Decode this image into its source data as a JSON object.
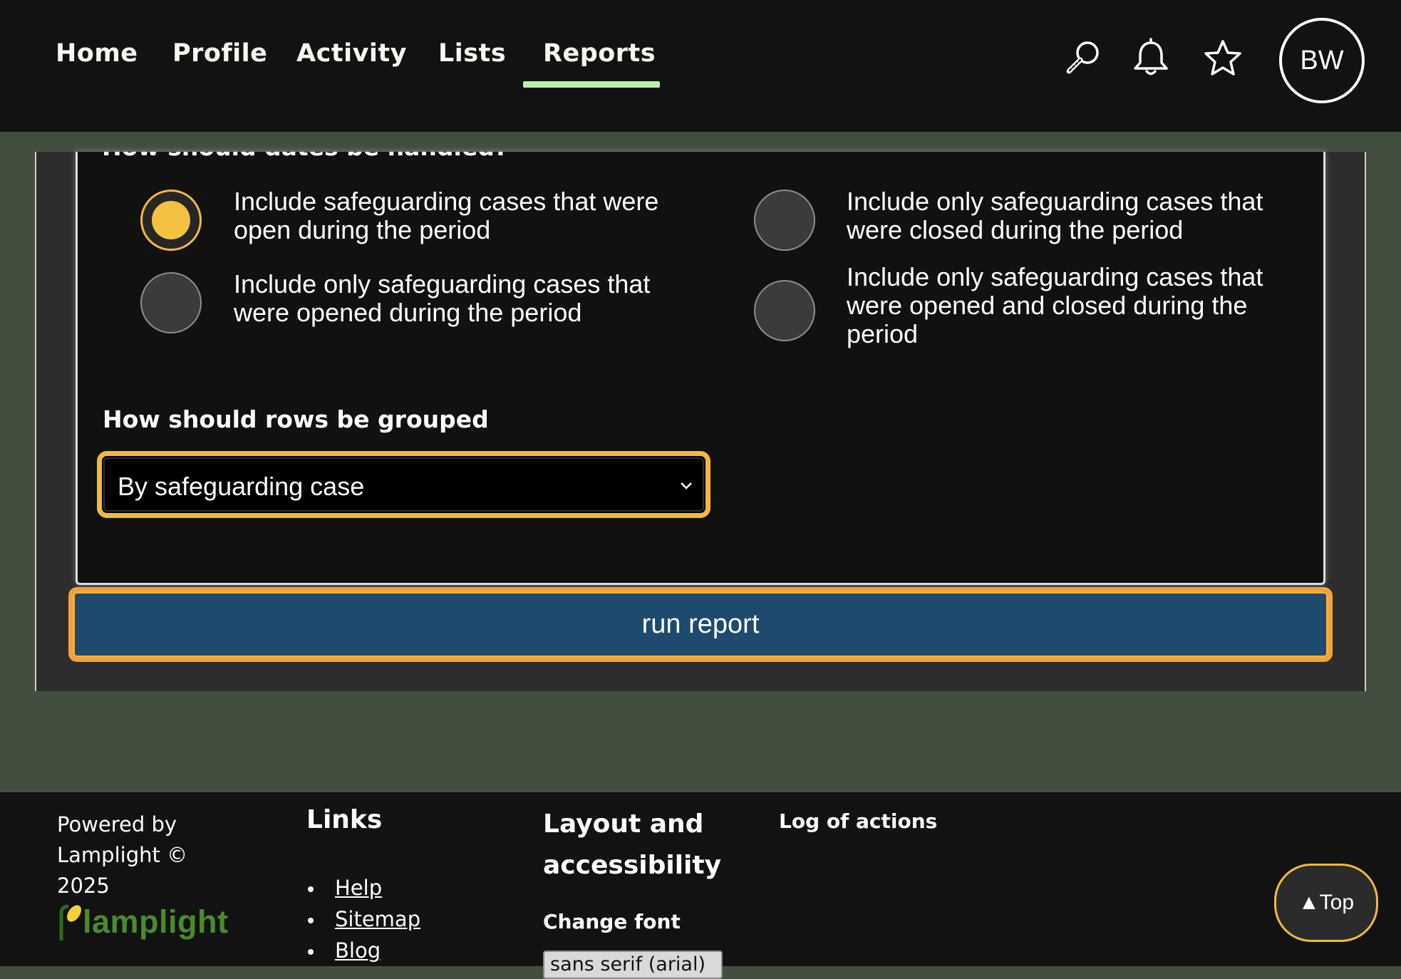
{
  "nav": {
    "items": [
      {
        "label": "Home"
      },
      {
        "label": "Profile"
      },
      {
        "label": "Activity"
      },
      {
        "label": "Lists"
      },
      {
        "label": "Reports",
        "active": true
      }
    ],
    "icons": [
      "search-icon",
      "bell-icon",
      "star-icon"
    ],
    "avatar_initials": "BW",
    "active_underline_color": "#b7f0a6"
  },
  "report_form": {
    "dates_heading": "How should dates be handled?",
    "date_options": [
      {
        "label": "Include safeguarding cases that were open during the period",
        "checked": true
      },
      {
        "label": "Include only safeguarding cases that were closed during the period",
        "checked": false
      },
      {
        "label": "Include only safeguarding cases that were opened during the period",
        "checked": false
      },
      {
        "label": "Include only safeguarding cases that were opened and closed during the period",
        "checked": false
      }
    ],
    "group_heading": "How should rows be grouped",
    "group_select_value": "By safeguarding case",
    "run_button_label": "run report"
  },
  "footer": {
    "powered_by": "Powered by Lamplight © 2025",
    "logo_text": "lamplight",
    "links_heading": "Links",
    "links": [
      "Help",
      "Sitemap",
      "Blog"
    ],
    "layout_heading": "Layout and accessibility",
    "change_font_label": "Change font",
    "font_select_value": "sans serif (arial)",
    "log_heading": "Log of actions",
    "top_button_label": "▲Top"
  },
  "colors": {
    "background": "#434f3e",
    "bars": "#121212",
    "accent_focus": "#f3b93c",
    "run_button": "#1e4a6e",
    "logo_green": "#4b8a2e"
  }
}
